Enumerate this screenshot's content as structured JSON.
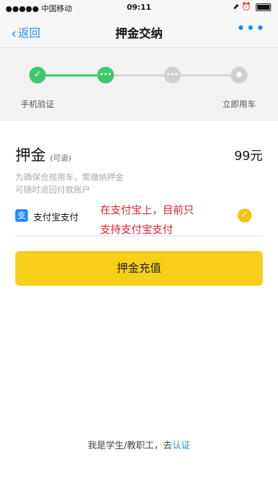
{
  "status_bar": {
    "carrier": "●●●●● 中国移动",
    "wifi_icon": "wifi-icon",
    "time": "09:11",
    "right_icons": "⬈ ⏰"
  },
  "nav": {
    "back_label": "返回",
    "title": "押金交纳",
    "more": "•••"
  },
  "steps": [
    {
      "label": "手机验证",
      "state": "done",
      "icon": "check-icon",
      "glyph": "✓",
      "color": "#3dc96a"
    },
    {
      "label": "",
      "state": "current",
      "icon": "dots-icon",
      "glyph": "•••",
      "color": "#3dc96a"
    },
    {
      "label": "",
      "state": "pending",
      "icon": "dots-icon",
      "glyph": "•••",
      "color": "#cfcfcf"
    },
    {
      "label": "立即用车",
      "state": "pending",
      "icon": "location-pin-icon",
      "glyph": "●",
      "color": "#cfcfcf"
    }
  ],
  "deposit": {
    "title": "押金",
    "subtitle": "(可退)",
    "amount": "99元",
    "desc_line1": "为确保合规用车，需缴纳押金",
    "desc_line2": "可随时退回付款账户"
  },
  "payment": {
    "alipay_icon": "alipay-icon",
    "alipay_icon_glyph": "支",
    "alipay_label": "支付宝支付",
    "selected": true,
    "check_glyph": "✓"
  },
  "annotation": {
    "line1": "在支付宝上，目前只",
    "line2": "支持支付宝支付",
    "color": "#e0202c"
  },
  "recharge_button": "押金充值",
  "bottom": {
    "text": "我是学生/教职工，去",
    "link": "认证"
  },
  "colors": {
    "accent_blue": "#1a8cff",
    "step_green": "#3dc96a",
    "button_yellow": "#f7cf1a"
  }
}
